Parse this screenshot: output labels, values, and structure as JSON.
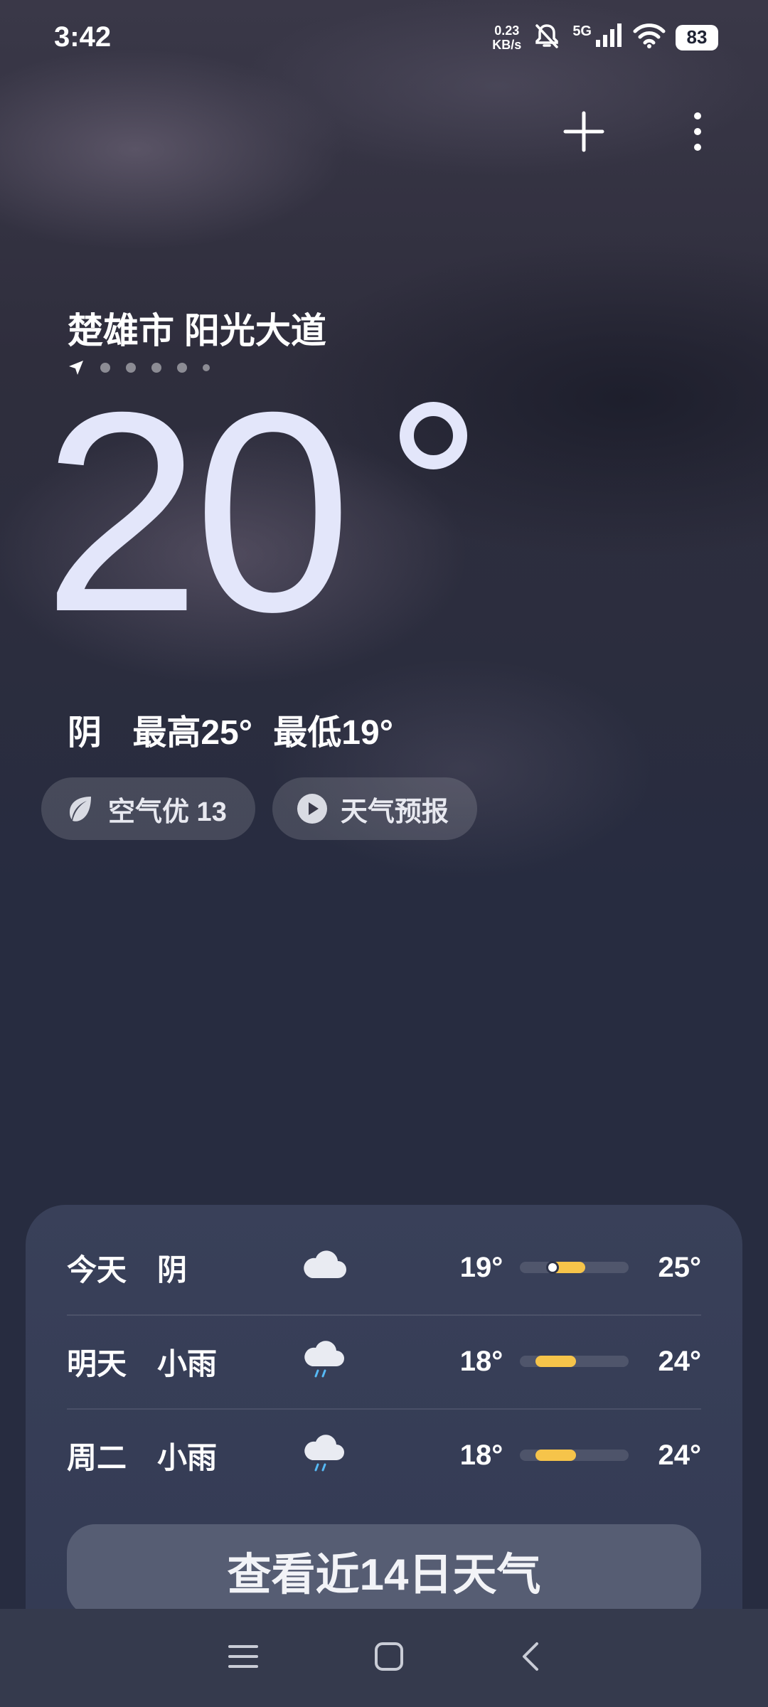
{
  "status_bar": {
    "time": "3:42",
    "net_speed_value": "0.23",
    "net_speed_unit": "KB/s",
    "network": "5G",
    "battery": "83",
    "icons": [
      "mute-icon",
      "signal-icon",
      "wifi-icon",
      "battery-icon"
    ]
  },
  "toolbar": {
    "add_icon": "plus-icon",
    "more_icon": "more-vertical-icon"
  },
  "location": {
    "name": "楚雄市 阳光大道",
    "page_count": 6,
    "current_page": 1
  },
  "current": {
    "temperature": "20",
    "condition": "阴",
    "high": "最高25°",
    "low": "最低19°"
  },
  "chips": {
    "air_quality": "空气优 13",
    "forecast_video": "天气预报"
  },
  "forecast": [
    {
      "day": "今天",
      "condition": "阴",
      "icon": "cloudy-icon",
      "low": "19°",
      "high": "25°",
      "range": [
        0.25,
        0.6
      ],
      "current_marker": 0.3
    },
    {
      "day": "明天",
      "condition": "小雨",
      "icon": "light-rain-icon",
      "low": "18°",
      "high": "24°",
      "range": [
        0.14,
        0.52
      ]
    },
    {
      "day": "周二",
      "condition": "小雨",
      "icon": "light-rain-icon",
      "low": "18°",
      "high": "24°",
      "range": [
        0.14,
        0.52
      ]
    }
  ],
  "more_button": "查看近14日天气",
  "colors": {
    "accent": "#f6c44a",
    "card": "#394059",
    "background": "#272c40"
  }
}
